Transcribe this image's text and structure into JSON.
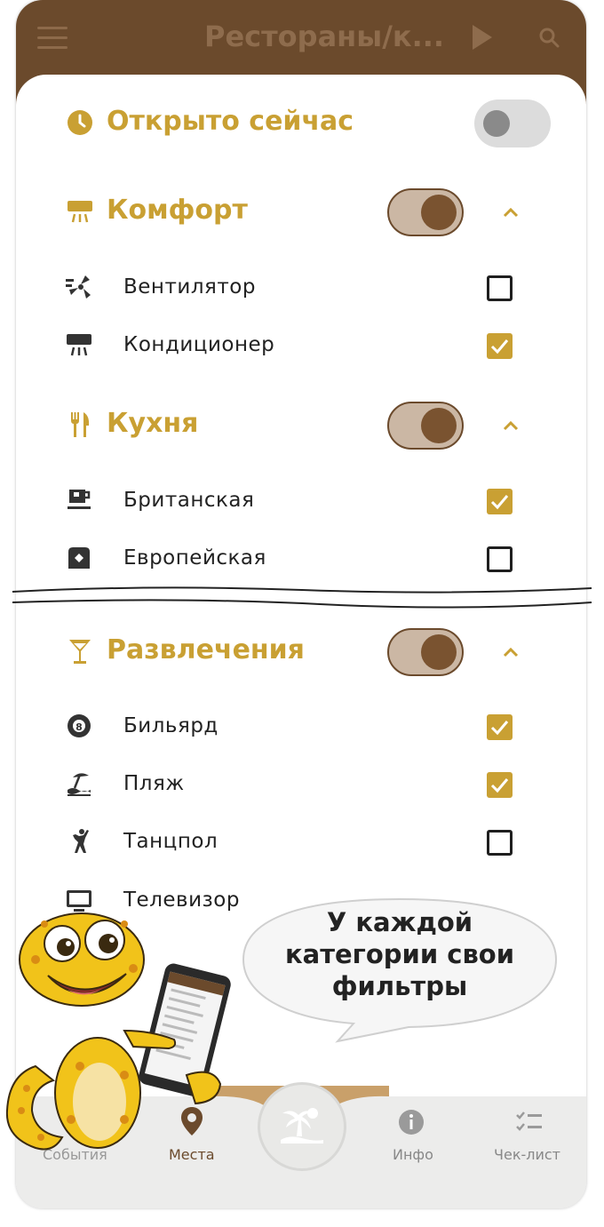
{
  "header": {
    "title": "Рестораны/к..."
  },
  "open_now": {
    "label": "Открыто сейчас",
    "enabled": false
  },
  "sections": [
    {
      "id": "comfort",
      "label": "Комфорт",
      "icon": "air-conditioner-icon",
      "enabled": true,
      "expanded": true,
      "items": [
        {
          "label": "Вентилятор",
          "icon": "fan-icon",
          "checked": false
        },
        {
          "label": "Кондиционер",
          "icon": "air-conditioner-icon",
          "checked": true
        }
      ]
    },
    {
      "id": "cuisine",
      "label": "Кухня",
      "icon": "fork-knife-icon",
      "enabled": true,
      "expanded": true,
      "items": [
        {
          "label": "Британская",
          "icon": "tea-cup-icon",
          "checked": true
        },
        {
          "label": "Европейская",
          "icon": "cuisine-icon",
          "checked": false
        }
      ]
    },
    {
      "id": "entertainment",
      "label": "Развлечения",
      "icon": "cocktail-icon",
      "enabled": true,
      "expanded": true,
      "items": [
        {
          "label": "Бильярд",
          "icon": "billiard-ball-icon",
          "checked": true
        },
        {
          "label": "Пляж",
          "icon": "beach-icon",
          "checked": true
        },
        {
          "label": "Танцпол",
          "icon": "dancer-icon",
          "checked": false
        },
        {
          "label": "Телевизор",
          "icon": "tv-icon",
          "checked": false
        }
      ]
    }
  ],
  "bottom_nav": {
    "events": "События",
    "places": "Места",
    "info": "Инфо",
    "checklist": "Чек-лист"
  },
  "callout": {
    "line1": "У каждой",
    "line2": "категории свои",
    "line3": "фильтры"
  },
  "colors": {
    "brown": "#6b4a2c",
    "gold": "#c9a033",
    "toggle_track": "#cbb7a4"
  }
}
